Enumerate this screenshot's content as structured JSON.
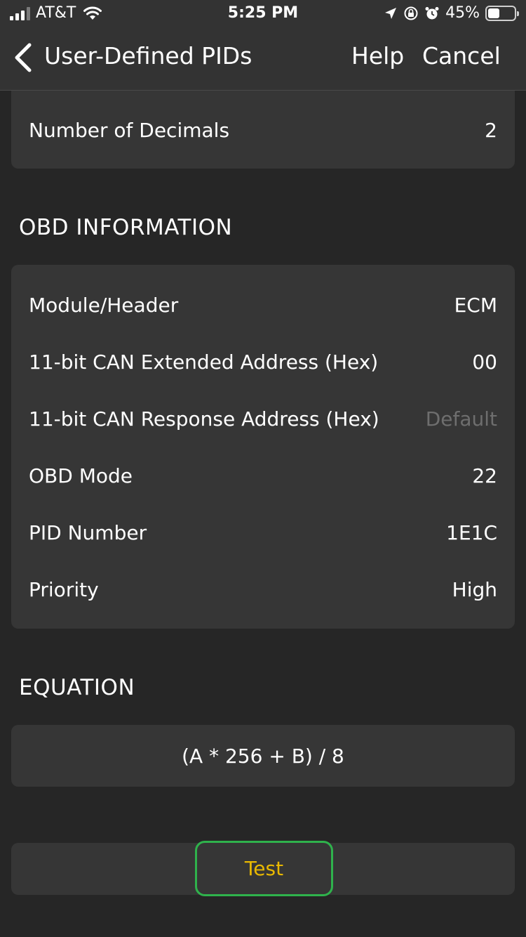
{
  "status_bar": {
    "carrier": "AT&T",
    "time": "5:25 PM",
    "battery_percent": "45%",
    "battery_level": 0.45
  },
  "nav": {
    "title": "User-Defined PIDs",
    "help_label": "Help",
    "cancel_label": "Cancel"
  },
  "top_card": {
    "rows": [
      {
        "label": "Number of Decimals",
        "value": "2"
      }
    ]
  },
  "obd_section": {
    "header": "OBD INFORMATION",
    "rows": [
      {
        "label": "Module/Header",
        "value": "ECM"
      },
      {
        "label": "11-bit CAN Extended Address (Hex)",
        "value": "00"
      },
      {
        "label": "11-bit CAN Response Address (Hex)",
        "value": "Default"
      },
      {
        "label": "OBD Mode",
        "value": "22"
      },
      {
        "label": "PID Number",
        "value": "1E1C"
      },
      {
        "label": "Priority",
        "value": "High"
      }
    ]
  },
  "equation_section": {
    "header": "EQUATION",
    "equation": "(A * 256 + B) / 8"
  },
  "test_button": {
    "label": "Test"
  },
  "colors": {
    "background": "#262626",
    "card": "#363636",
    "header_band": "#333333",
    "test_text": "#e8b800",
    "test_outline": "#2fb24c",
    "placeholder_text": "#6e6e6e"
  },
  "icons": [
    "cellular-signal-icon",
    "wifi-icon",
    "location-arrow-icon",
    "orientation-lock-icon",
    "alarm-icon",
    "battery-icon",
    "chevron-left-icon"
  ]
}
